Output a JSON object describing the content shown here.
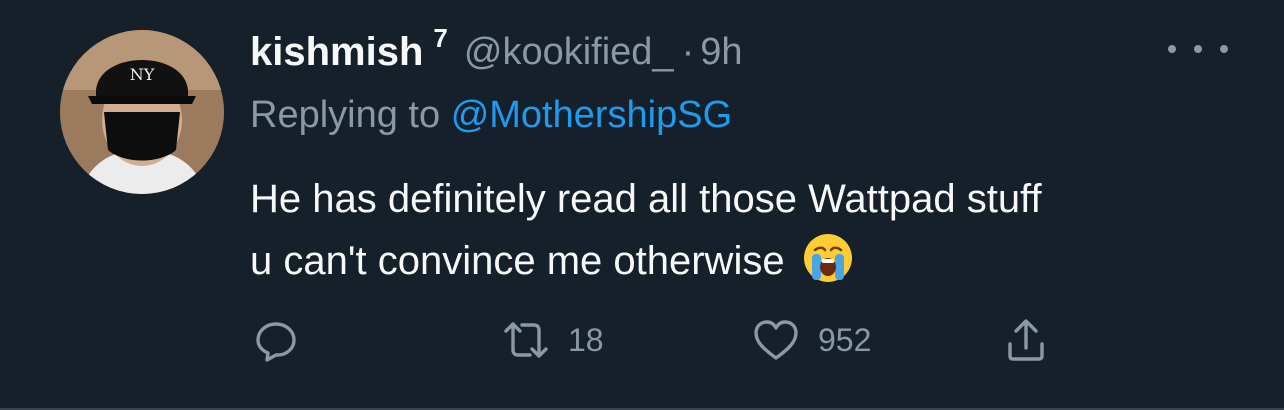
{
  "tweet": {
    "author": {
      "name": "kishmish",
      "superscript": "7",
      "handle": "@kookified_",
      "separator": "·",
      "time": "9h"
    },
    "replying": {
      "prefix": "Replying to",
      "mention": "@MothershipSG"
    },
    "text": {
      "line1": "He has definitely read all those Wattpad stuff",
      "line2": "u can't convince me otherwise"
    },
    "actions": {
      "retweets": "18",
      "likes": "952"
    }
  },
  "icons": [
    "more-icon",
    "reply-icon",
    "retweet-icon",
    "like-icon",
    "share-icon",
    "crying-emoji"
  ],
  "colors": {
    "background": "#15202b",
    "text": "#f7f9f9",
    "muted": "#8b98a5",
    "link": "#1d9bf0"
  }
}
